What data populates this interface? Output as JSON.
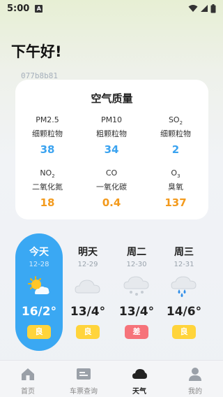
{
  "status_bar": {
    "time": "5:00",
    "notif_letter": "A"
  },
  "greeting": "下午好!",
  "code": "077b8b81",
  "air_quality": {
    "title": "空气质量",
    "items": [
      {
        "name": "PM2.5",
        "sub": "",
        "desc": "细颗粒物",
        "value": "38",
        "color": "#3ba3f0"
      },
      {
        "name": "PM10",
        "sub": "",
        "desc": "粗颗粒物",
        "value": "34",
        "color": "#3ba3f0"
      },
      {
        "name": "SO",
        "sub": "2",
        "desc": "细颗粒物",
        "value": "2",
        "color": "#3ba3f0"
      },
      {
        "name": "NO",
        "sub": "2",
        "desc": "二氧化氮",
        "value": "18",
        "color": "#f39a1c"
      },
      {
        "name": "CO",
        "sub": "",
        "desc": "一氧化碳",
        "value": "0.4",
        "color": "#f39a1c"
      },
      {
        "name": "O",
        "sub": "3",
        "desc": "臭氧",
        "value": "137",
        "color": "#f39a1c"
      }
    ]
  },
  "forecast": [
    {
      "day": "今天",
      "date": "12-28",
      "icon": "sun-cloud-icon",
      "temp": "16/2°",
      "quality": "良",
      "quality_color": "#ffd43b"
    },
    {
      "day": "明天",
      "date": "12-29",
      "icon": "cloud-icon",
      "temp": "13/4°",
      "quality": "良",
      "quality_color": "#ffd43b"
    },
    {
      "day": "周二",
      "date": "12-30",
      "icon": "snow-cloud-icon",
      "temp": "13/4°",
      "quality": "差",
      "quality_color": "#f6737a"
    },
    {
      "day": "周三",
      "date": "12-31",
      "icon": "rain-cloud-icon",
      "temp": "14/6°",
      "quality": "良",
      "quality_color": "#ffd43b"
    }
  ],
  "tabs": [
    {
      "label": "首页",
      "icon": "home-icon",
      "active": false
    },
    {
      "label": "车票查询",
      "icon": "ticket-icon",
      "active": false
    },
    {
      "label": "天气",
      "icon": "weather-icon",
      "active": true
    },
    {
      "label": "我的",
      "icon": "user-icon",
      "active": false
    }
  ]
}
